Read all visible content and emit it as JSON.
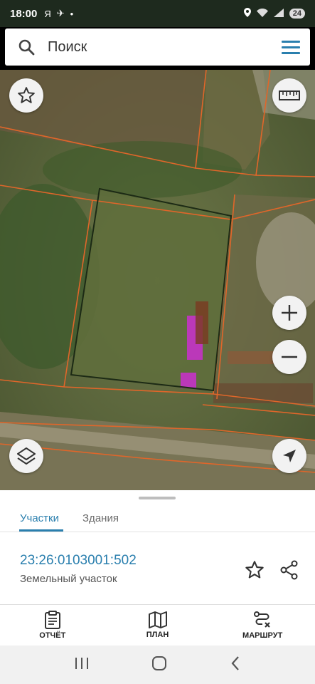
{
  "status_bar": {
    "time": "18:00",
    "left_icons": [
      "Я",
      "✈",
      "•"
    ],
    "battery": "24"
  },
  "search": {
    "placeholder": "Поиск"
  },
  "map": {
    "buttons": [
      "favorite",
      "ruler",
      "zoom-in",
      "zoom-out",
      "layers",
      "locate"
    ]
  },
  "sheet": {
    "tabs": [
      {
        "label": "Участки",
        "active": true
      },
      {
        "label": "Здания",
        "active": false
      }
    ],
    "parcel": {
      "cadastral_number": "23:26:0103001:502",
      "type": "Земельный участок"
    }
  },
  "bottom_nav": {
    "items": [
      {
        "label": "ОТЧЁТ",
        "icon": "clipboard-icon"
      },
      {
        "label": "ПЛАН",
        "icon": "map-icon"
      },
      {
        "label": "МАРШРУТ",
        "icon": "route-icon"
      }
    ]
  },
  "colors": {
    "accent": "#2a7fae",
    "parcel_line": "#e0662a",
    "building": "#c532c7"
  }
}
